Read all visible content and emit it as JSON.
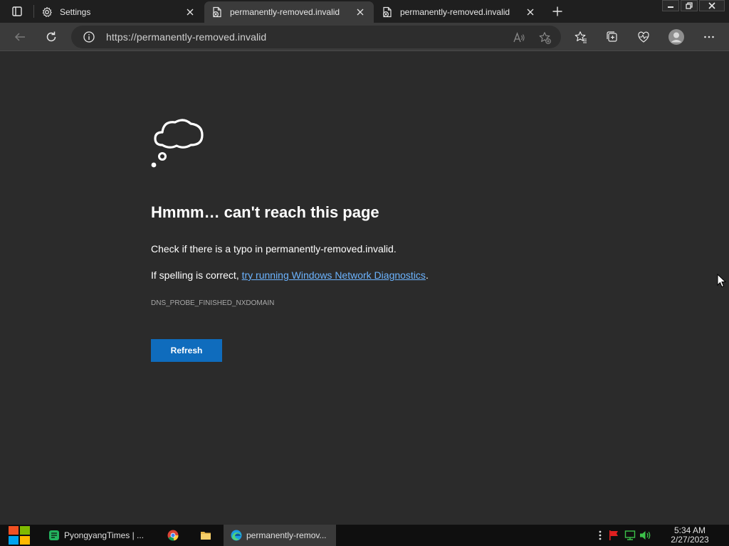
{
  "tabs": [
    {
      "label": "Settings",
      "icon": "gear-icon",
      "active": false
    },
    {
      "label": "permanently-removed.invalid",
      "icon": "broken-page-icon",
      "active": true
    },
    {
      "label": "permanently-removed.invalid",
      "icon": "broken-page-icon",
      "active": false
    }
  ],
  "toolbar": {
    "url": "https://permanently-removed.invalid"
  },
  "error": {
    "title": "Hmmm… can't reach this page",
    "line1": "Check if there is a typo in permanently-removed.invalid.",
    "line2_prefix": "If spelling is correct, ",
    "line2_link": "try running Windows Network Diagnostics",
    "line2_suffix": ".",
    "code": "DNS_PROBE_FINISHED_NXDOMAIN",
    "refresh_label": "Refresh"
  },
  "taskbar": {
    "items": [
      {
        "label": "PyongyangTimes | ...",
        "icon": "green-app-icon"
      },
      {
        "label": "",
        "icon": "chrome-icon"
      },
      {
        "label": "",
        "icon": "folder-icon"
      },
      {
        "label": "permanently-remov...",
        "icon": "edge-icon"
      }
    ],
    "time": "5:34 AM",
    "date": "2/27/2023"
  },
  "colors": {
    "accent": "#0f6cbd",
    "link": "#6cb4ff",
    "page_bg": "#2b2b2b",
    "tabstrip_bg": "#1f1f1f",
    "toolbar_bg": "#3b3b3b"
  }
}
